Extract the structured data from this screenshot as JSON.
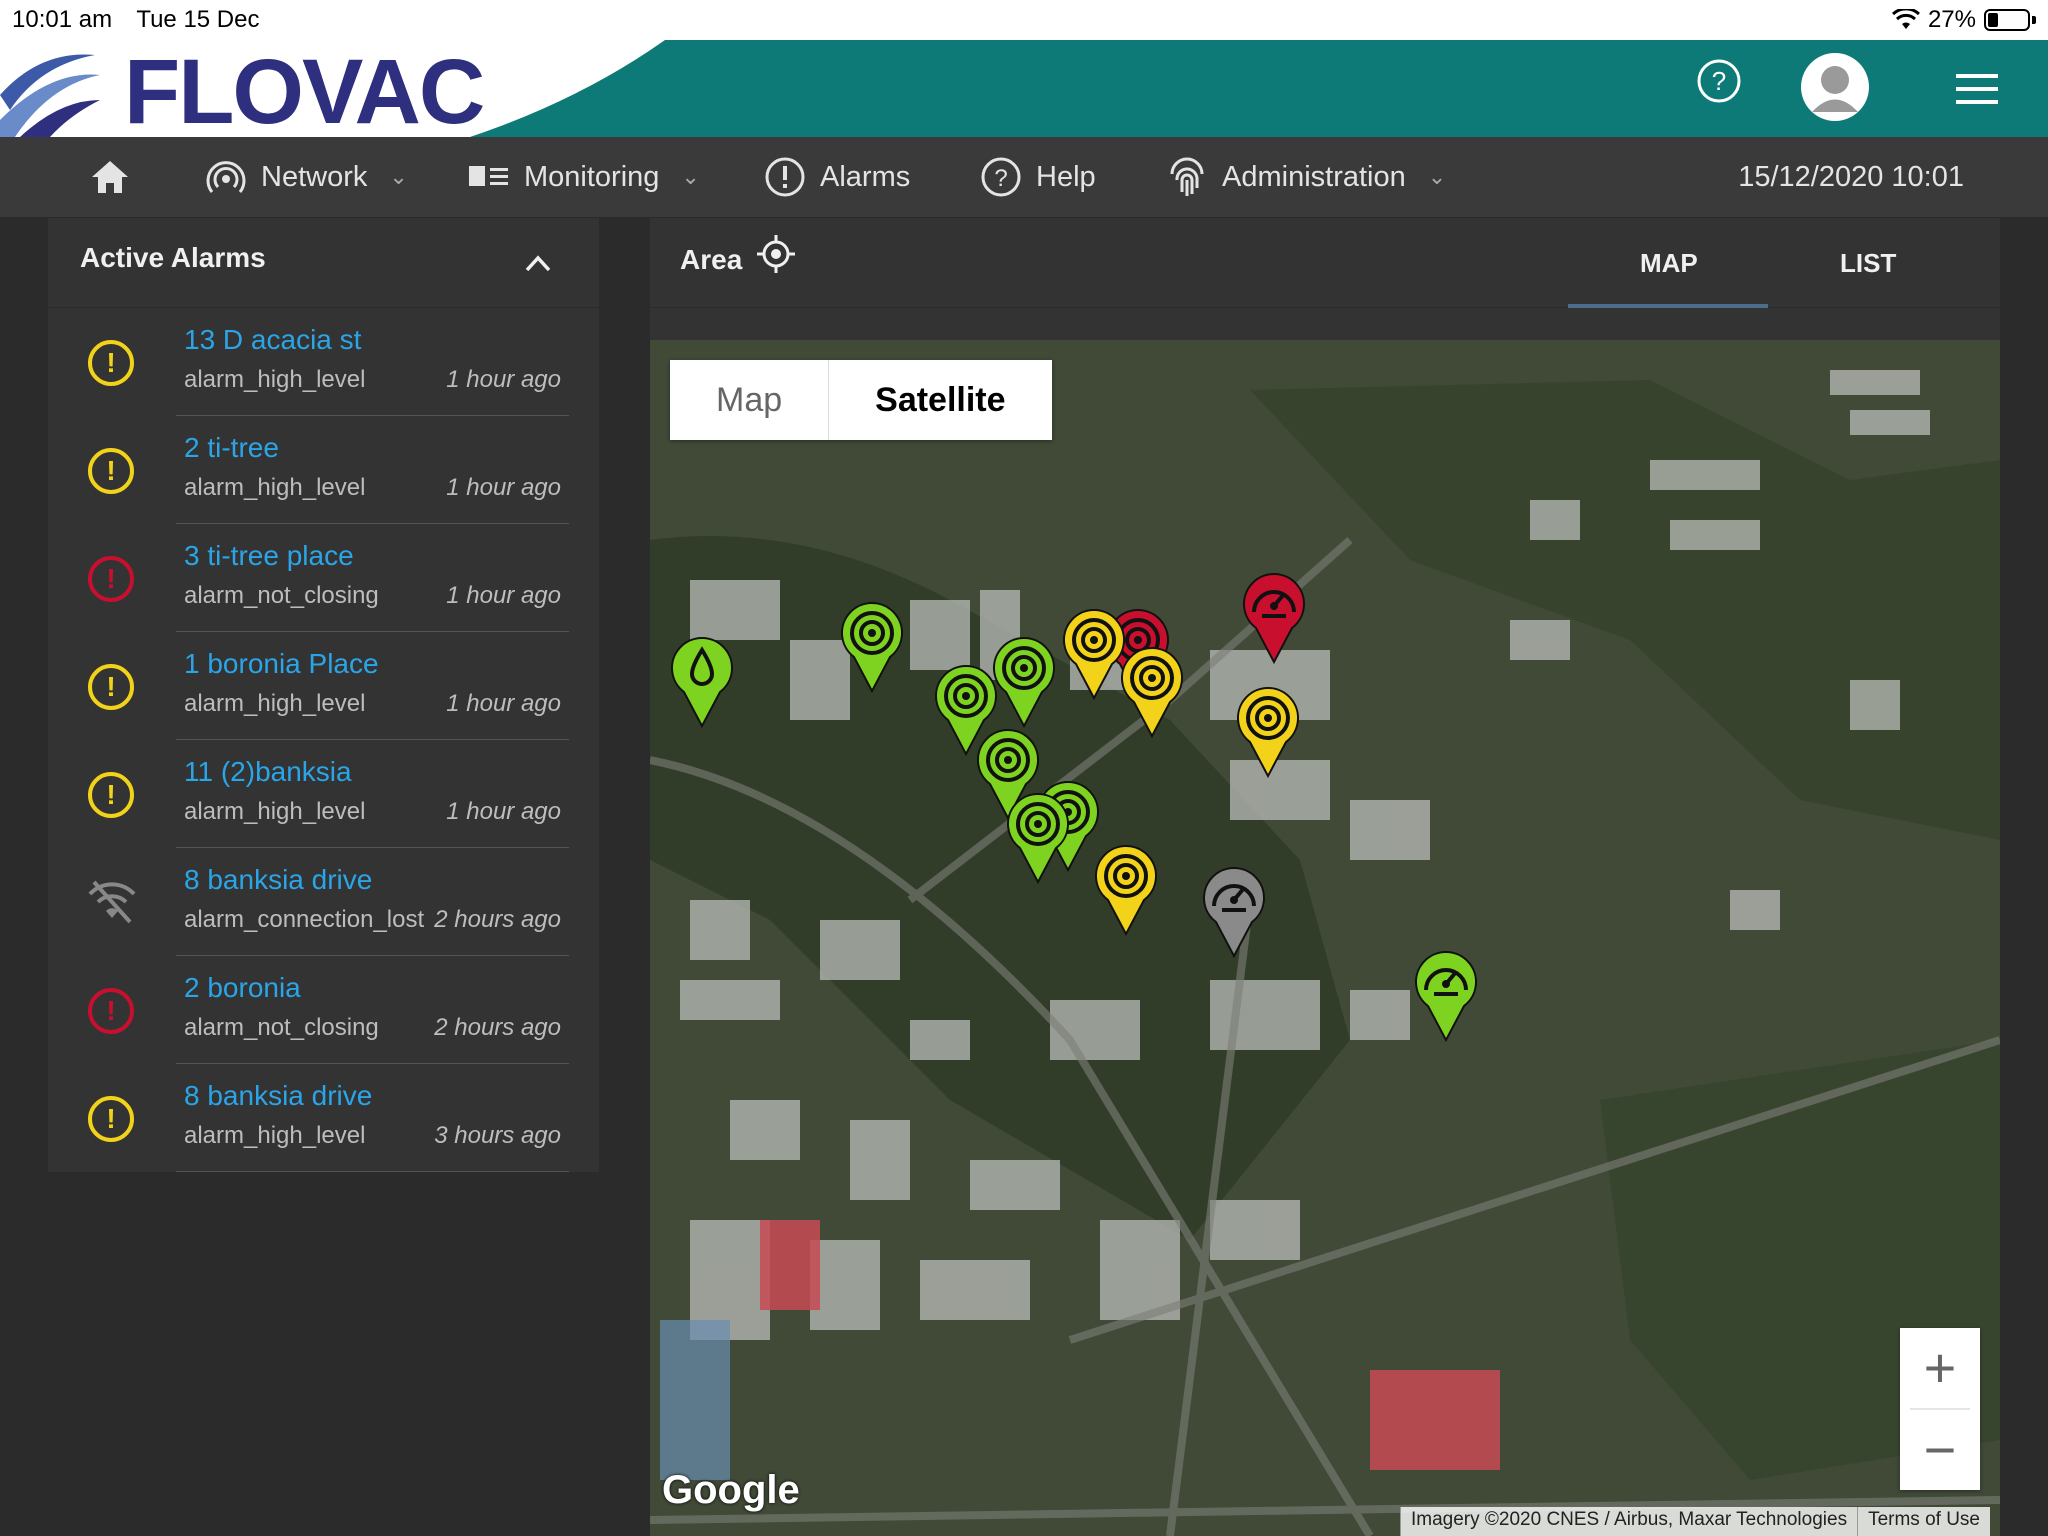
{
  "status_bar": {
    "time": "10:01 am",
    "date": "Tue 15 Dec",
    "battery": "27%"
  },
  "header": {
    "logo": "FLOVAC",
    "icons": [
      "help-icon",
      "avatar",
      "menu-icon"
    ]
  },
  "nav": {
    "items": [
      {
        "label": "Network",
        "icon": "network-icon"
      },
      {
        "label": "Monitoring",
        "icon": "monitoring-icon"
      },
      {
        "label": "Alarms",
        "icon": "alarm-icon"
      },
      {
        "label": "Help",
        "icon": "help-icon"
      },
      {
        "label": "Administration",
        "icon": "fingerprint-icon"
      }
    ],
    "datetime": "15/12/2020 10:01"
  },
  "alarms_panel": {
    "title": "Active Alarms",
    "items": [
      {
        "name": "13 D acacia st",
        "type": "alarm_high_level",
        "time": "1 hour ago",
        "severity": "yellow"
      },
      {
        "name": "2 ti-tree",
        "type": "alarm_high_level",
        "time": "1 hour ago",
        "severity": "yellow"
      },
      {
        "name": "3 ti-tree place",
        "type": "alarm_not_closing",
        "time": "1 hour ago",
        "severity": "red"
      },
      {
        "name": "1 boronia Place",
        "type": "alarm_high_level",
        "time": "1 hour ago",
        "severity": "yellow"
      },
      {
        "name": "11 (2)banksia",
        "type": "alarm_high_level",
        "time": "1 hour ago",
        "severity": "yellow"
      },
      {
        "name": "8 banksia drive",
        "type": "alarm_connection_lost",
        "time": "2 hours ago",
        "severity": "offline"
      },
      {
        "name": "2 boronia",
        "type": "alarm_not_closing",
        "time": "2 hours ago",
        "severity": "red"
      },
      {
        "name": "8 banksia drive",
        "type": "alarm_high_level",
        "time": "3 hours ago",
        "severity": "yellow"
      }
    ]
  },
  "map_panel": {
    "area_label": "Area",
    "tabs": [
      "MAP",
      "LIST"
    ],
    "active_tab": "MAP",
    "map_type": {
      "map": "Map",
      "satellite": "Satellite",
      "selected": "Satellite"
    },
    "zoom": {
      "in": "+",
      "out": "−"
    },
    "google": "Google",
    "attribution": "Imagery ©2020 CNES / Airbus, Maxar Technologies",
    "terms": "Terms of Use"
  },
  "colors": {
    "header": "#0d7a77",
    "nav": "#3a3a3a",
    "link": "#2aa5e8",
    "yellow": "#f2d31a",
    "red": "#c8102e",
    "green": "#7ed321"
  }
}
